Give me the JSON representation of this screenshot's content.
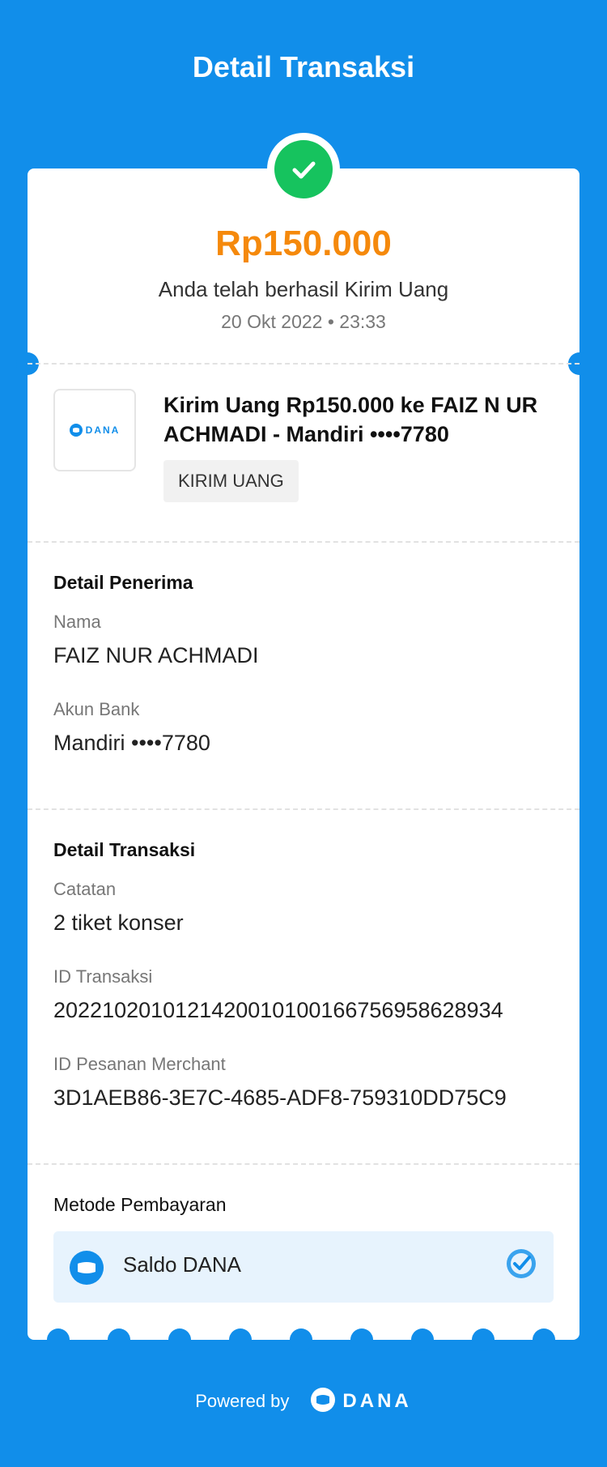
{
  "header": {
    "title": "Detail Transaksi"
  },
  "summary": {
    "amount": "Rp150.000",
    "status_text": "Anda telah berhasil Kirim Uang",
    "datetime": "20 Okt 2022 • 23:33"
  },
  "transaction": {
    "logo_text": "DANA",
    "title": "Kirim Uang Rp150.000 ke FAIZ N UR ACHMADI - Mandiri ••••7780",
    "tag": "KIRIM UANG"
  },
  "recipient": {
    "heading": "Detail Penerima",
    "name_label": "Nama",
    "name_value": "FAIZ NUR ACHMADI",
    "bank_label": "Akun Bank",
    "bank_value": "Mandiri ••••7780"
  },
  "details": {
    "heading": "Detail Transaksi",
    "note_label": "Catatan",
    "note_value": "2 tiket konser",
    "txid_label": "ID Transaksi",
    "txid_value": "2022102010121420010100166756958628934",
    "order_label": "ID Pesanan Merchant",
    "order_value": "3D1AEB86-3E7C-4685-ADF8-759310DD75C9"
  },
  "payment": {
    "label": "Metode Pembayaran",
    "method": "Saldo DANA"
  },
  "footer": {
    "powered_by": "Powered by",
    "brand": "DANA"
  },
  "colors": {
    "background": "#118eea",
    "amount": "#f5890c",
    "success": "#16c35e"
  },
  "icons": [
    "check-icon",
    "dana-logo-icon",
    "wallet-icon",
    "verified-check-icon"
  ]
}
